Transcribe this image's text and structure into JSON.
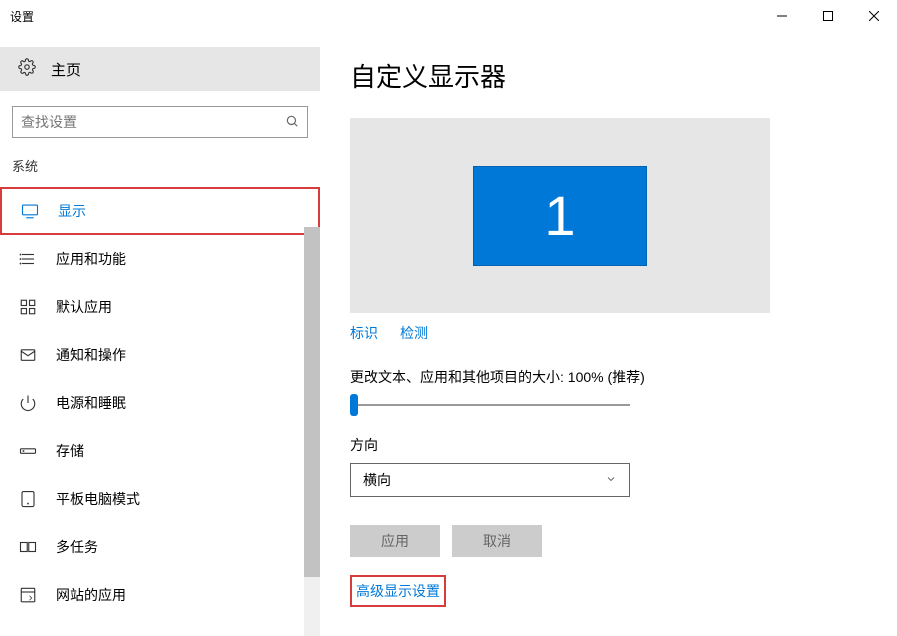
{
  "window": {
    "title": "设置"
  },
  "sidebar": {
    "home_label": "主页",
    "search_placeholder": "查找设置",
    "category_label": "系统",
    "items": [
      {
        "label": "显示",
        "active": true
      },
      {
        "label": "应用和功能"
      },
      {
        "label": "默认应用"
      },
      {
        "label": "通知和操作"
      },
      {
        "label": "电源和睡眠"
      },
      {
        "label": "存储"
      },
      {
        "label": "平板电脑模式"
      },
      {
        "label": "多任务"
      },
      {
        "label": "网站的应用"
      }
    ]
  },
  "main": {
    "title": "自定义显示器",
    "monitor_number": "1",
    "links": {
      "identify": "标识",
      "detect": "检测"
    },
    "scaling_label": "更改文本、应用和其他项目的大小: 100% (推荐)",
    "orientation_label": "方向",
    "orientation_value": "横向",
    "apply_label": "应用",
    "cancel_label": "取消",
    "advanced_label": "高级显示设置"
  }
}
